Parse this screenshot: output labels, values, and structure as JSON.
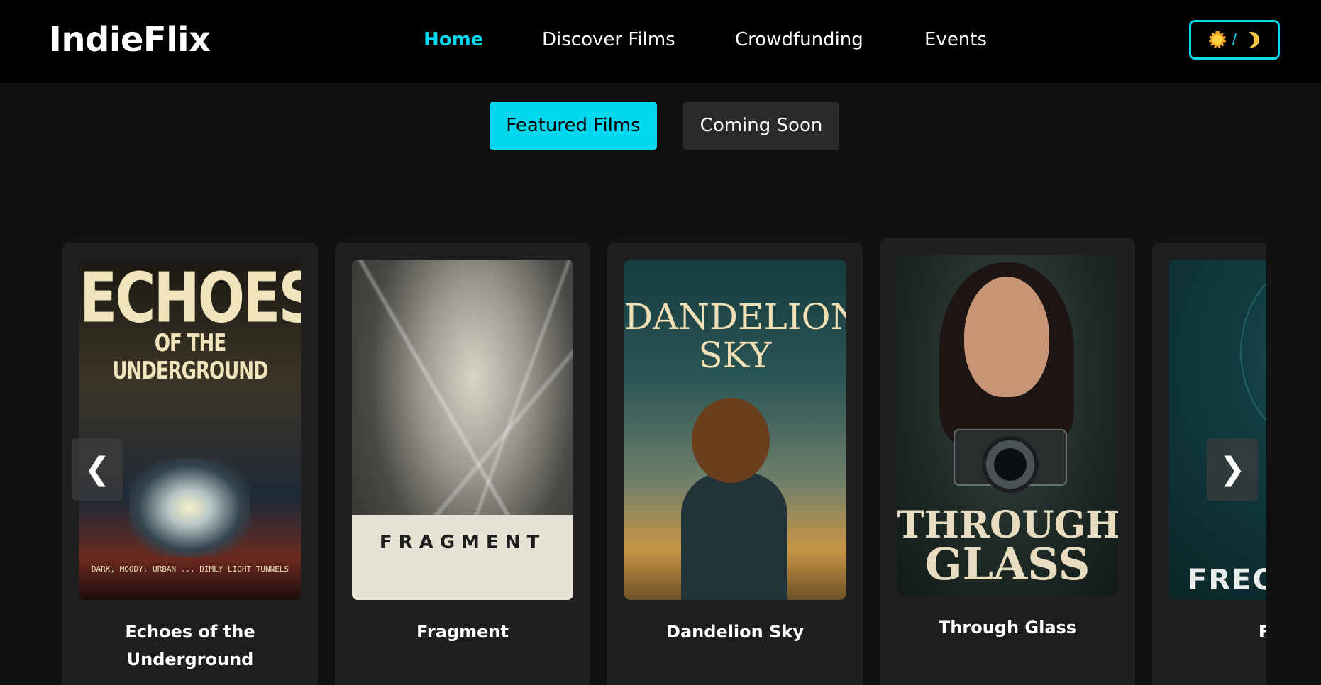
{
  "header": {
    "logo": "IndieFlix",
    "nav": [
      "Home",
      "Discover Films",
      "Crowdfunding",
      "Events"
    ],
    "active_nav": "Home",
    "theme_toggle": {
      "separator": "/",
      "icons": [
        "sun-icon",
        "moon-icon"
      ]
    }
  },
  "tabs": {
    "featured": "Featured Films",
    "coming": "Coming Soon",
    "active": "Featured Films"
  },
  "carousel": {
    "prev_icon": "❮",
    "next_icon": "❯",
    "films": [
      {
        "title_line1": "Echoes of the",
        "title_line2": "Underground",
        "poster_title": "ECHOES",
        "poster_subtitle": "OF THE UNDERGROUND",
        "poster_fine": "DARK, MOODY, URBAN ... DIMLY LIGHT TUNNELS"
      },
      {
        "title": "Fragment",
        "poster_title": "FRAGMENT"
      },
      {
        "title": "Dandelion Sky",
        "poster_title_line1": "DANDELION",
        "poster_title_line2": "SKY"
      },
      {
        "title": "Through Glass",
        "poster_title_line1": "THROUGH",
        "poster_title_line2": "GLASS"
      },
      {
        "title": "Freq",
        "poster_title": "FREQ"
      }
    ]
  },
  "colors": {
    "accent": "#00d8f0",
    "background": "#111111",
    "header_bg": "#000000",
    "card_bg": "#1e1e1e",
    "tab_inactive": "#2a2a2a"
  }
}
